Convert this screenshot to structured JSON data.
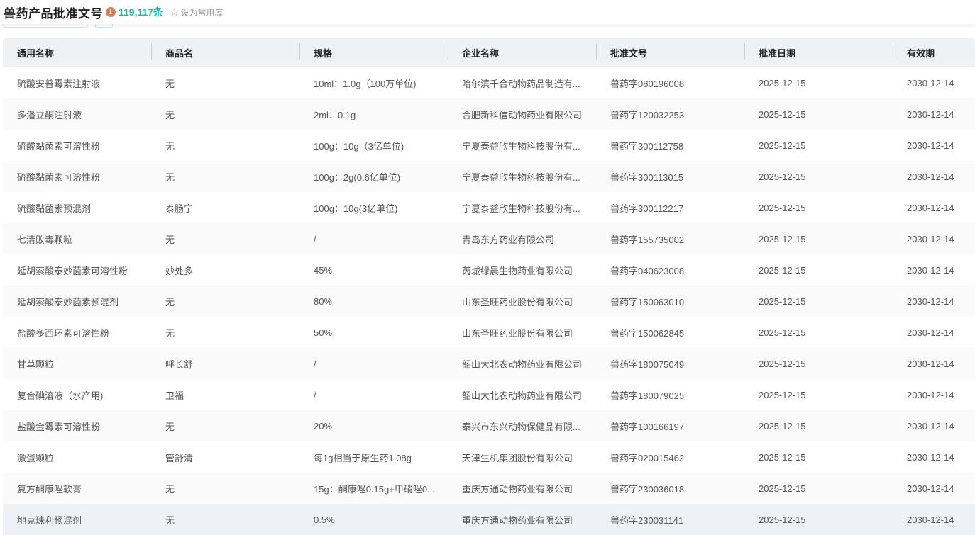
{
  "header": {
    "title": "兽药产品批准文号",
    "count": "119,117条",
    "favorite_label": "设为常用库"
  },
  "columns": [
    "通用名称",
    "商品名",
    "规格",
    "企业名称",
    "批准文号",
    "批准日期",
    "有效期"
  ],
  "rows": [
    [
      "硫酸安普霉素注射液",
      "无",
      "10ml：1.0g（100万单位)",
      "哈尔滨千合动物药品制造有...",
      "兽药字080196008",
      "2025-12-15",
      "2030-12-14"
    ],
    [
      "多潘立酮注射液",
      "无",
      "2ml：0.1g",
      "合肥新科信动物药业有限公司",
      "兽药字120032253",
      "2025-12-15",
      "2030-12-14"
    ],
    [
      "硫酸黏菌素可溶性粉",
      "无",
      "100g：10g（3亿单位)",
      "宁夏泰益欣生物科技股份有...",
      "兽药字300112758",
      "2025-12-15",
      "2030-12-14"
    ],
    [
      "硫酸黏菌素可溶性粉",
      "无",
      "100g：2g(0.6亿单位)",
      "宁夏泰益欣生物科技股份有...",
      "兽药字300113015",
      "2025-12-15",
      "2030-12-14"
    ],
    [
      "硫酸黏菌素预混剂",
      "泰肠宁",
      "100g：10g(3亿单位)",
      "宁夏泰益欣生物科技股份有...",
      "兽药字300112217",
      "2025-12-15",
      "2030-12-14"
    ],
    [
      "七清败毒颗粒",
      "无",
      "/",
      "青岛东方药业有限公司",
      "兽药字155735002",
      "2025-12-15",
      "2030-12-14"
    ],
    [
      "延胡索酸泰妙菌素可溶性粉",
      "妙处多",
      "45%",
      "芮城绿晨生物药业有限公司",
      "兽药字040623008",
      "2025-12-15",
      "2030-12-14"
    ],
    [
      "延胡索酸泰妙菌素预混剂",
      "无",
      "80%",
      "山东圣旺药业股份有限公司",
      "兽药字150063010",
      "2025-12-15",
      "2030-12-14"
    ],
    [
      "盐酸多西环素可溶性粉",
      "无",
      "50%",
      "山东圣旺药业股份有限公司",
      "兽药字150062845",
      "2025-12-15",
      "2030-12-14"
    ],
    [
      "甘草颗粒",
      "呼长舒",
      "/",
      "韶山大北农动物药业有限公司",
      "兽药字180075049",
      "2025-12-15",
      "2030-12-14"
    ],
    [
      "复合碘溶液（水产用)",
      "卫福",
      "/",
      "韶山大北农动物药业有限公司",
      "兽药字180079025",
      "2025-12-15",
      "2030-12-14"
    ],
    [
      "盐酸金霉素可溶性粉",
      "无",
      "20%",
      "泰兴市东兴动物保健品有限...",
      "兽药字100166197",
      "2025-12-15",
      "2030-12-14"
    ],
    [
      "激蛋颗粒",
      "管舒清",
      "每1g相当于原生药1.08g",
      "天津生机集团股份有限公司",
      "兽药字020015462",
      "2025-12-15",
      "2030-12-14"
    ],
    [
      "复方酮康唑软膏",
      "无",
      "15g：酮康唑0.15g+甲硝唑0...",
      "重庆方通动物药业有限公司",
      "兽药字230036018",
      "2025-12-15",
      "2030-12-14"
    ],
    [
      "地克珠利预混剂",
      "无",
      "0.5%",
      "重庆方通动物药业有限公司",
      "兽药字230031141",
      "2025-12-15",
      "2030-12-14"
    ]
  ]
}
